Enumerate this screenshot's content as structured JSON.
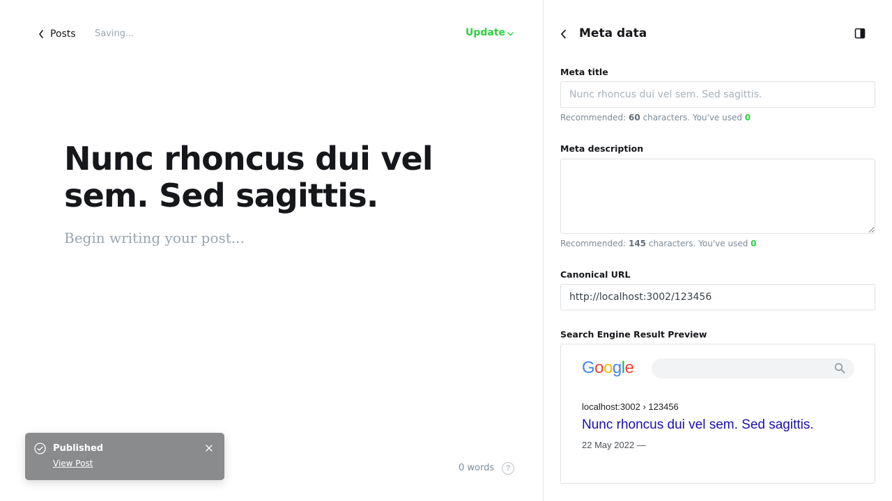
{
  "editor": {
    "back_label": "Posts",
    "status": "Saving...",
    "update_label": "Update",
    "title": "Nunc rhoncus dui vel sem. Sed sagittis.",
    "body_placeholder": "Begin writing your post...",
    "word_count": "0 words",
    "help_glyph": "?"
  },
  "toast": {
    "title": "Published",
    "link_label": "View Post"
  },
  "settings": {
    "heading": "Meta data",
    "meta_title": {
      "label": "Meta title",
      "placeholder": "Nunc rhoncus dui vel sem. Sed sagittis.",
      "value": "",
      "hint_prefix": "Recommended: ",
      "recommended": "60",
      "hint_middle": " characters. You've used ",
      "used": "0"
    },
    "meta_description": {
      "label": "Meta description",
      "value": "",
      "hint_prefix": "Recommended: ",
      "recommended": "145",
      "hint_middle": " characters. You've used ",
      "used": "0"
    },
    "canonical_url": {
      "label": "Canonical URL",
      "value": "http://localhost:3002/123456"
    },
    "serp": {
      "label": "Search Engine Result Preview",
      "logo_letters": [
        "G",
        "o",
        "o",
        "g",
        "l",
        "e"
      ],
      "logo_colors": [
        "#4285f4",
        "#ea4335",
        "#fbbc05",
        "#4285f4",
        "#34a853",
        "#ea4335"
      ],
      "breadcrumb": "localhost:3002 › 123456",
      "result_title": "Nunc rhoncus dui vel sem. Sed sagittis.",
      "result_date": "22 May 2022 —"
    }
  },
  "colors": {
    "accent_green": "#30cf43",
    "serp_link": "#1a0dab",
    "toast_bg": "#8a8b8c"
  }
}
